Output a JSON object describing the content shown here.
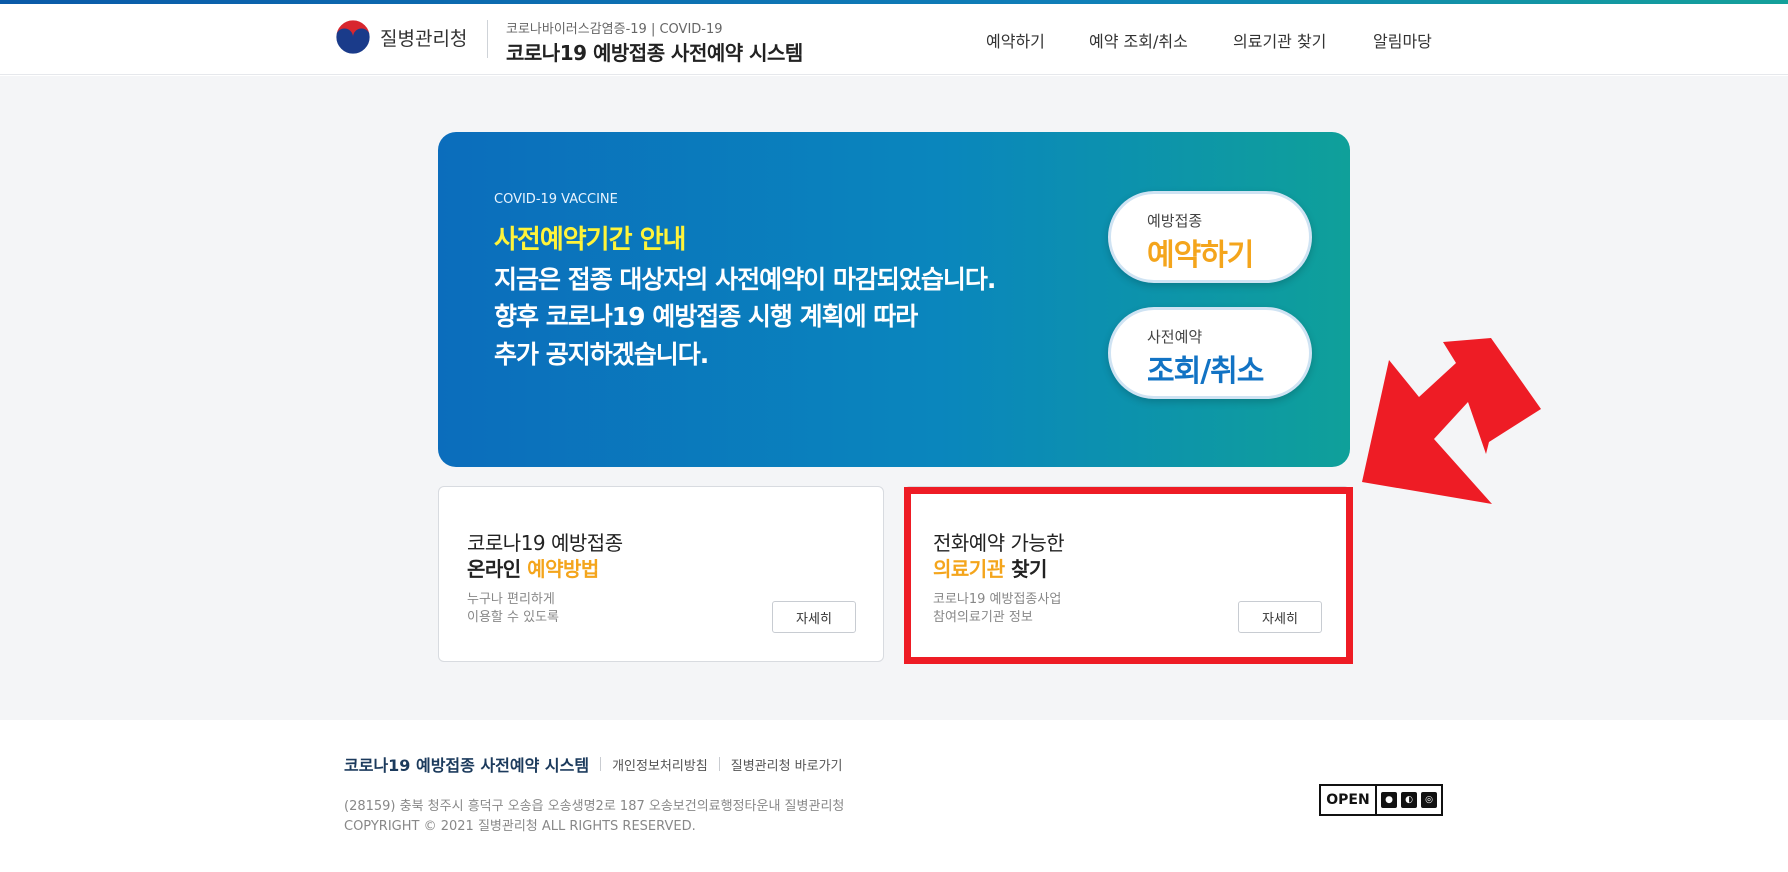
{
  "header": {
    "logo_text": "질병관리청",
    "subtitle": "코로나바이러스감염증-19 | COVID-19",
    "title": "코로나19 예방접종 사전예약 시스템",
    "nav": [
      "예약하기",
      "예약 조회/취소",
      "의료기관 찾기",
      "알림마당"
    ]
  },
  "banner": {
    "kicker": "COVID-19 VACCINE",
    "headline": "사전예약기간 안내",
    "lines": [
      "지금은 접종 대상자의 사전예약이 마감되었습니다.",
      "향후 코로나19 예방접종 시행 계획에 따라",
      "추가 공지하겠습니다."
    ],
    "buttons": [
      {
        "small": "예방접종",
        "big": "예약하기",
        "color": "#f4a51c"
      },
      {
        "small": "사전예약",
        "big": "조회/취소",
        "color": "#1273c4"
      }
    ]
  },
  "cards": [
    {
      "line1": "코로나19 예방접종",
      "line2_plain": "온라인 ",
      "line2_highlight": "예약방법",
      "line2_after": "",
      "desc": [
        "누구나 편리하게",
        "이용할 수 있도록"
      ],
      "button": "자세히"
    },
    {
      "line1": "전화예약 가능한",
      "line2_plain": "",
      "line2_highlight": "의료기관",
      "line2_after": " 찾기",
      "desc": [
        "코로나19 예방접종사업",
        "참여의료기관 정보"
      ],
      "button": "자세히"
    }
  ],
  "footer": {
    "title": "코로나19 예방접종 사전예약 시스템",
    "links": [
      "개인정보처리방침",
      "질병관리청 바로가기"
    ],
    "address": "(28159) 충북 청주시 흥덕구 오송읍 오송생명2로 187 오송보건의료행정타운내 질병관리청",
    "copyright": "COPYRIGHT © 2021 질병관리청 ALL RIGHTS RESERVED.",
    "open_badge": "OPEN"
  },
  "colors": {
    "accent_orange": "#f4a51c",
    "accent_blue": "#1273c4",
    "highlight_red": "#ee1c25",
    "banner_yellow": "#fff43a"
  }
}
